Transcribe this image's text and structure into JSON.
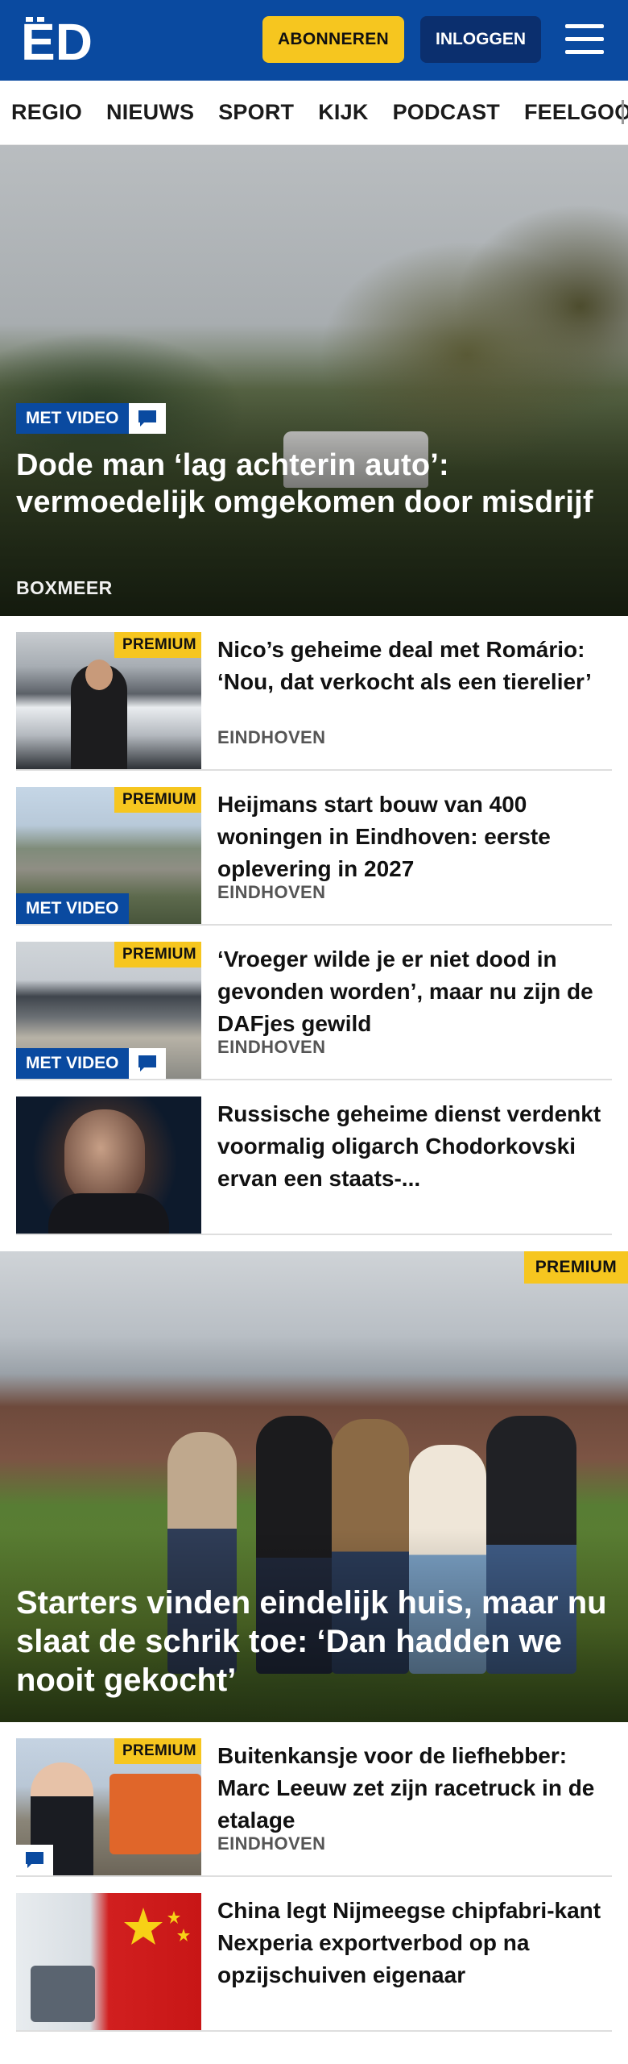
{
  "header": {
    "logo_text": "ED",
    "subscribe_label": "ABONNEREN",
    "login_label": "INLOGGEN",
    "menu_icon": "hamburger-menu-icon",
    "brand_color": "#0a4aa0",
    "accent_color": "#f6c61f"
  },
  "nav": {
    "items": [
      "REGIO",
      "NIEUWS",
      "SPORT",
      "KIJK",
      "PODCAST",
      "FEELGOOD"
    ]
  },
  "hero": {
    "badge": "MET VIDEO",
    "comment_icon": "comment-icon",
    "title": "Dode man ‘lag achterin auto’: vermoedelijk omgekomen door misdrijf",
    "location": "BOXMEER"
  },
  "articles": [
    {
      "premium": "PREMIUM",
      "title": "Nico’s geheime deal met Romário: ‘Nou, dat verkocht als een tierelier’",
      "location": "EINDHOVEN"
    },
    {
      "premium": "PREMIUM",
      "badge": "MET VIDEO",
      "title": "Heijmans start bouw van 400 woningen in Eindhoven: eerste oplevering in 2027",
      "location": "EINDHOVEN"
    },
    {
      "premium": "PREMIUM",
      "badge": "MET VIDEO",
      "title": "‘Vroeger wilde je er niet dood in gevonden worden’, maar nu zijn de DAFjes gewild",
      "location": "EINDHOVEN"
    },
    {
      "title": "Russische geheime dienst verdenkt voormalig oligarch Chodorkovski ervan een staats-..."
    }
  ],
  "feature": {
    "premium": "PREMIUM",
    "title": "Starters vinden eindelijk huis, maar nu slaat de schrik toe: ‘Dan hadden we nooit gekocht’"
  },
  "articles_bottom": [
    {
      "premium": "PREMIUM",
      "title": "Buitenkansje voor de liefhebber: Marc Leeuw zet zijn racetruck in de etalage",
      "location": "EINDHOVEN"
    },
    {
      "title": "China legt Nijmeegse chipfabri-kant Nexperia exportverbod op na opzijschuiven eigenaar"
    }
  ]
}
